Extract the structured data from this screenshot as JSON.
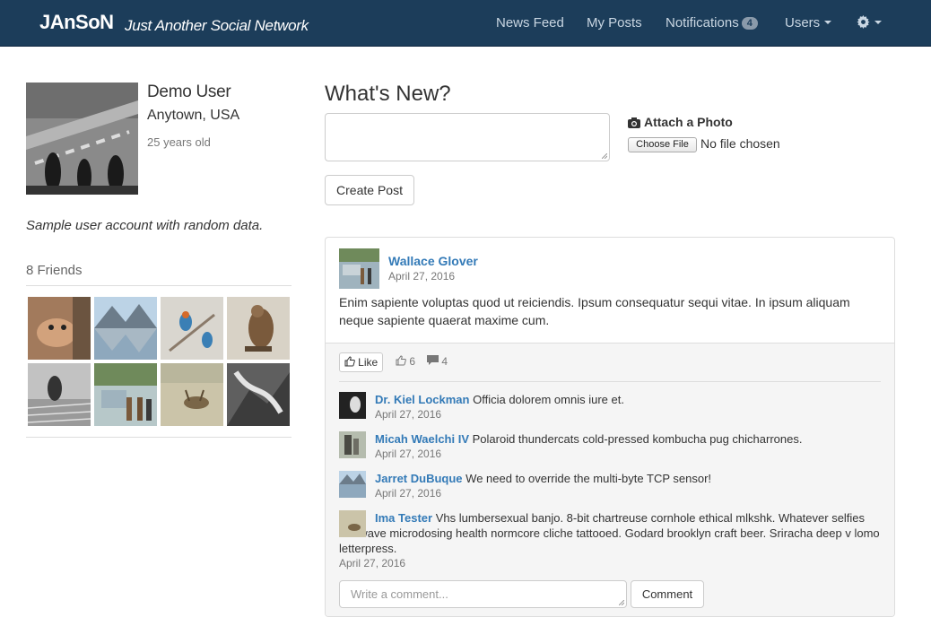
{
  "navbar": {
    "brand": "JAnSoN",
    "tagline": "Just Another Social Network",
    "items": [
      {
        "label": "News Feed"
      },
      {
        "label": "My Posts"
      },
      {
        "label": "Notifications",
        "badge": "4"
      },
      {
        "label": "Users"
      }
    ],
    "settings_icon": "gear-icon",
    "colors": {
      "navbar_bg": "#1c3d5a",
      "link": "#c9d6e2",
      "accent_link": "#337ab7"
    }
  },
  "profile": {
    "name": "Demo User",
    "location": "Anytown, USA",
    "age": "25 years old",
    "bio": "Sample user account with random data.",
    "friends_label": "8 Friends"
  },
  "composer": {
    "heading": "What's New?",
    "attach_label": "Attach a Photo",
    "choose_file": "Choose File",
    "no_file": "No file chosen",
    "create_button": "Create Post"
  },
  "post": {
    "author": "Wallace Glover",
    "date": "April 27, 2016",
    "body": "Enim sapiente voluptas quod ut reiciendis. Ipsum consequatur sequi vitae. In ipsum aliquam neque sapiente quaerat maxime cum.",
    "like_label": "Like",
    "likes_count": "6",
    "comments_count": "4",
    "comments": [
      {
        "author": "Dr. Kiel Lockman",
        "text": "Officia dolorem omnis iure et.",
        "date": "April 27, 2016"
      },
      {
        "author": "Micah Waelchi IV",
        "text": "Polaroid thundercats cold-pressed kombucha pug chicharrones.",
        "date": "April 27, 2016"
      },
      {
        "author": "Jarret DuBuque",
        "text": "We need to override the multi-byte TCP sensor!",
        "date": "April 27, 2016"
      },
      {
        "author": "Ima Tester",
        "text": "Vhs lumbersexual banjo. 8-bit chartreuse cornhole ethical mlkshk. Whatever selfies chillwave microdosing health normcore cliche tattooed. Godard brooklyn craft beer. Sriracha deep v lomo letterpress.",
        "date": "April 27, 2016"
      }
    ],
    "comment_placeholder": "Write a comment...",
    "comment_button": "Comment"
  }
}
